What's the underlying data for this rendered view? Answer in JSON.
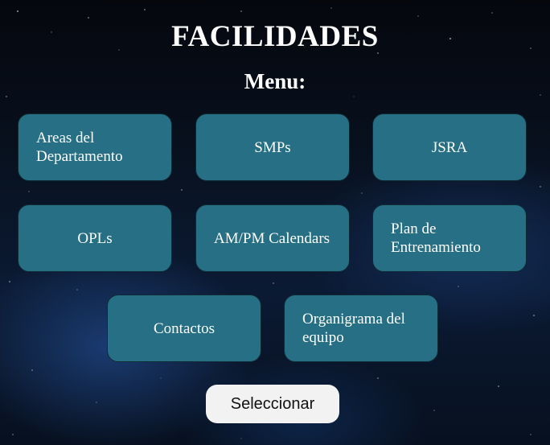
{
  "header": {
    "title": "FACILIDADES",
    "subtitle": "Menu:"
  },
  "menu": {
    "items": [
      {
        "label": "Areas del Departamento"
      },
      {
        "label": "SMPs"
      },
      {
        "label": "JSRA"
      },
      {
        "label": "OPLs"
      },
      {
        "label": "AM/PM Calendars"
      },
      {
        "label": "Plan de Entrenamiento"
      },
      {
        "label": "Contactos"
      },
      {
        "label": "Organigrama del equipo"
      }
    ]
  },
  "actions": {
    "select_label": "Seleccionar"
  },
  "colors": {
    "tile_background": "#266f84",
    "button_background": "#f2f2f2",
    "text": "#ffffff"
  }
}
